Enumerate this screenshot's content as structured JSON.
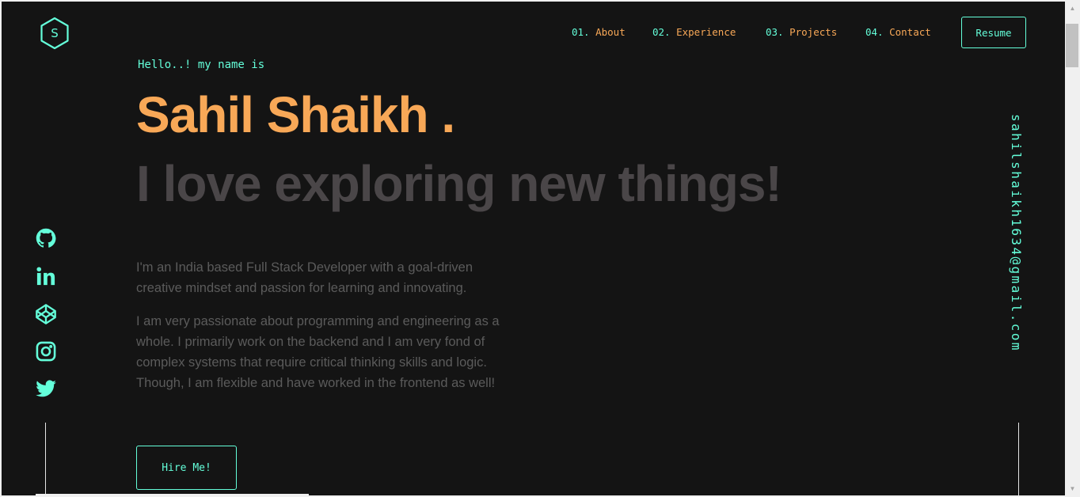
{
  "header": {
    "logo_letter": "S",
    "nav": [
      {
        "num": "01.",
        "label": "About"
      },
      {
        "num": "02.",
        "label": "Experience"
      },
      {
        "num": "03.",
        "label": "Projects"
      },
      {
        "num": "04.",
        "label": "Contact"
      }
    ],
    "resume_label": "Resume"
  },
  "hero": {
    "greeting": "Hello..! my name is",
    "name": "Sahil Shaikh .",
    "tagline": "I love exploring new things!",
    "paragraphs": [
      "I'm an India based Full Stack Developer with a goal-driven creative mindset and passion for learning and innovating.",
      "I am very passionate about programming and engineering as a whole. I primarily work on the backend and I am very fond of complex systems that require critical thinking skills and logic. Though, I am flexible and have worked in the frontend as well!"
    ],
    "cta_label": "Hire Me!"
  },
  "social": {
    "icons": [
      "github-icon",
      "linkedin-icon",
      "codepen-icon",
      "instagram-icon",
      "twitter-icon"
    ]
  },
  "email": "sahilshaikh1634@gmail.com",
  "colors": {
    "background": "#141414",
    "accent": "#64ffda",
    "name": "#f8a857",
    "tagline": "#4a4648",
    "body_text": "#5b5b5b"
  }
}
